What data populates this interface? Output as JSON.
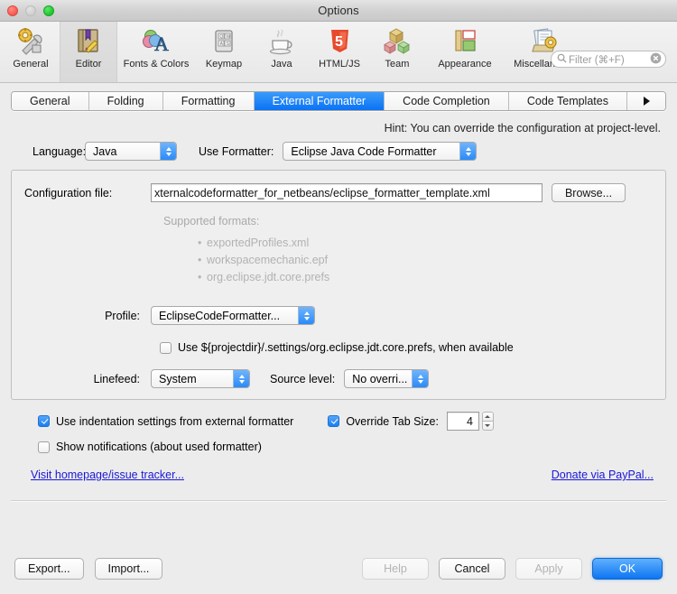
{
  "window": {
    "title": "Options",
    "controls": [
      "close",
      "minimize",
      "zoom"
    ]
  },
  "toolbar": {
    "items": [
      {
        "label": "General",
        "icon": "gear-wrench-icon",
        "selected": false
      },
      {
        "label": "Editor",
        "icon": "editor-book-icon",
        "selected": true
      },
      {
        "label": "Fonts & Colors",
        "icon": "fonts-colors-icon",
        "selected": false
      },
      {
        "label": "Keymap",
        "icon": "keyboard-icon",
        "selected": false
      },
      {
        "label": "Java",
        "icon": "coffee-cup-icon",
        "selected": false
      },
      {
        "label": "HTML/JS",
        "icon": "html5-shield-icon",
        "selected": false
      },
      {
        "label": "Team",
        "icon": "team-cubes-icon",
        "selected": false
      },
      {
        "label": "Appearance",
        "icon": "appearance-icon",
        "selected": false
      },
      {
        "label": "Miscellaneous",
        "icon": "miscellaneous-icon",
        "selected": false
      }
    ],
    "filter": {
      "placeholder": "Filter (⌘+F)",
      "search_icon": "search-icon",
      "clear_icon": "clear-circle-icon"
    }
  },
  "tabs": {
    "items": [
      {
        "label": "General",
        "active": false
      },
      {
        "label": "Folding",
        "active": false
      },
      {
        "label": "Formatting",
        "active": false
      },
      {
        "label": "External Formatter",
        "active": true
      },
      {
        "label": "Code Completion",
        "active": false
      },
      {
        "label": "Code Templates",
        "active": false
      }
    ],
    "overflow_icon": "chevron-right-icon"
  },
  "main": {
    "hint": "Hint: You can override the configuration at project-level.",
    "language": {
      "label": "Language:",
      "value": "Java"
    },
    "use_formatter": {
      "label": "Use Formatter:",
      "value": "Eclipse Java Code Formatter"
    },
    "config_file": {
      "label": "Configuration file:",
      "value": "xternalcodeformatter_for_netbeans/eclipse_formatter_template.xml",
      "browse_label": "Browse..."
    },
    "supported_formats": {
      "title": "Supported formats:",
      "items": [
        "exportedProfiles.xml",
        "workspacemechanic.epf",
        "org.eclipse.jdt.core.prefs"
      ]
    },
    "profile": {
      "label": "Profile:",
      "value": "EclipseCodeFormatter..."
    },
    "project_prefs_checkbox": {
      "label": "Use ${projectdir}/.settings/org.eclipse.jdt.core.prefs, when available",
      "checked": false
    },
    "linefeed": {
      "label": "Linefeed:",
      "value": "System"
    },
    "source_level": {
      "label": "Source level:",
      "value": "No overri..."
    },
    "use_indentation": {
      "label": "Use indentation settings from external formatter",
      "checked": true
    },
    "override_tab_size": {
      "label": "Override Tab Size:",
      "checked": true,
      "value": "4"
    },
    "show_notifications": {
      "label": "Show notifications (about used formatter)",
      "checked": false
    },
    "homepage_link": "Visit homepage/issue tracker...",
    "donate_link": "Donate via PayPal..."
  },
  "footer": {
    "export": "Export...",
    "import": "Import...",
    "help": "Help",
    "cancel": "Cancel",
    "apply": "Apply",
    "ok": "OK"
  },
  "colors": {
    "accent_blue": "#0a72f4",
    "default_button": "#0d75f2",
    "link": "#1a18d6",
    "disabled_text": "#b3b3b3",
    "muted_text": "#b2b2b2"
  }
}
